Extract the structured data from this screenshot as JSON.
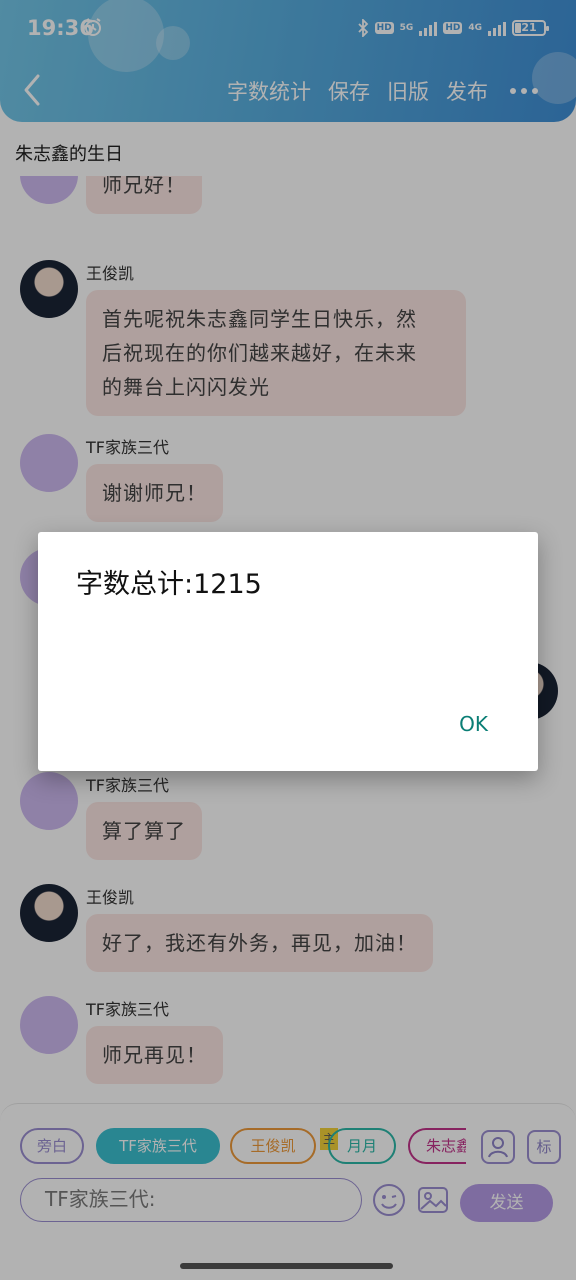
{
  "status_bar": {
    "time": "19:36",
    "bluetooth_icon": "bluetooth-icon",
    "hd1": "HD",
    "net1": "5G",
    "hd2": "HD",
    "net2": "4G",
    "battery": "21"
  },
  "navbar": {
    "actions": [
      "字数统计",
      "保存",
      "旧版",
      "发布"
    ]
  },
  "script_title": "朱志鑫的生日",
  "messages": [
    {
      "sender": "",
      "avatar": "bot",
      "text": "师兄好！"
    },
    {
      "sender": "王俊凯",
      "avatar": "photo",
      "text": "首先呢祝朱志鑫同学生日快乐，然\n后祝现在的你们越来越好，在未来\n的舞台上闪闪发光"
    },
    {
      "sender": "TF家族三代",
      "avatar": "bot",
      "text": "谢谢师兄！"
    },
    {
      "sender": "TF家族三代",
      "avatar": "bot",
      "text": "算了算了"
    },
    {
      "sender": "王俊凯",
      "avatar": "photo",
      "text": "好了，我还有外务，再见，加油！"
    },
    {
      "sender": "TF家族三代",
      "avatar": "bot",
      "text": "师兄再见！"
    }
  ],
  "roles": [
    {
      "label": "旁白",
      "selected": false,
      "color": "#9b8fd1"
    },
    {
      "label": "TF家族三代",
      "selected": true,
      "color": "#3cc0d0"
    },
    {
      "label": "王俊凯",
      "selected": false,
      "color": "#ee9a3a"
    },
    {
      "label": "月月",
      "selected": false,
      "color": "#2bb8a8"
    },
    {
      "label": "朱志鑫",
      "selected": false,
      "color": "#c2338a"
    }
  ],
  "main_tag": "主",
  "mark_button": "标",
  "input": {
    "value": "TF家族三代:"
  },
  "send_label": "发送",
  "dialog": {
    "title": "字数总计:1215",
    "ok_label": "OK"
  },
  "colors": {
    "header_start": "#74c7e8",
    "header_end": "#3f8fd6",
    "accent": "#b59be6",
    "bubble_bg": "#fbe6e3",
    "ok_text": "#0a7e75"
  }
}
